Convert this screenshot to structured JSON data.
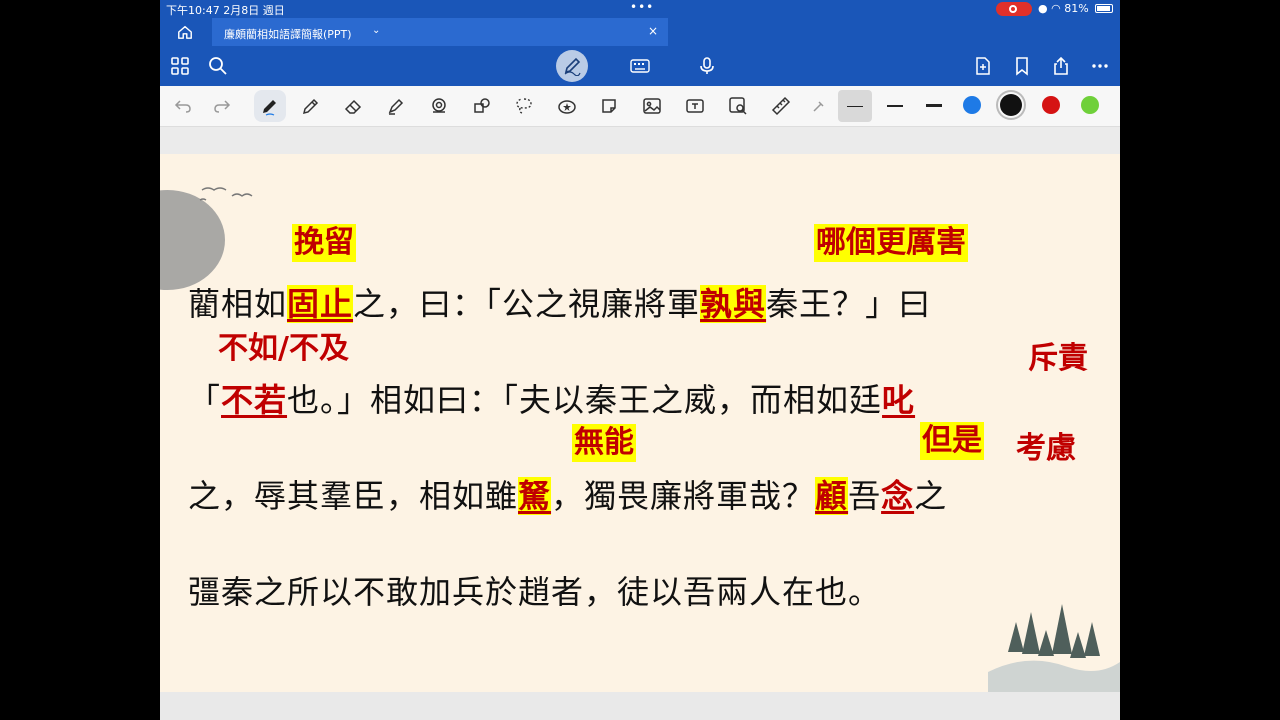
{
  "status_bar": {
    "time_date": "下午10:47   2月8日 週日",
    "battery": "81%"
  },
  "tab": {
    "title": "廉頗藺相如語譯簡報(PPT)",
    "chevron": "⌄",
    "close": "×"
  },
  "toolbar_icons": [
    "grid-icon",
    "search-icon",
    "pen-mode-icon",
    "keyboard-icon",
    "microphone-icon",
    "add-page-icon",
    "bookmark-icon",
    "share-icon",
    "more-icon"
  ],
  "draw_tools": [
    "undo-icon",
    "redo-icon",
    "pen-icon",
    "pencil-icon",
    "eraser-icon",
    "highlighter-icon",
    "lasso-icon",
    "shapes-icon",
    "lasso-select-icon",
    "sticker-icon",
    "sticky-note-icon",
    "image-icon",
    "text-box-icon",
    "image-search-icon",
    "ruler-icon",
    "laser-icon"
  ],
  "colors": {
    "accent": "#1a56b8",
    "red": "#c00000",
    "highlight": "#ffff00",
    "slide_bg": "#fdf3e4"
  },
  "swatches": [
    {
      "name": "blue",
      "color": "#1e7ae6"
    },
    {
      "name": "black",
      "color": "#111111"
    },
    {
      "name": "red",
      "color": "#d51313"
    },
    {
      "name": "green",
      "color": "#6fd03a"
    }
  ],
  "slide": {
    "line1": {
      "a": "藺相如",
      "b": "固止",
      "c": "之，曰：「公之視廉將軍",
      "d": "孰與",
      "e": "秦王？」曰"
    },
    "line2": {
      "a": "「",
      "b": "不若",
      "c": "也。」相如曰：「夫以秦王之威，而相如廷",
      "d": "叱"
    },
    "line3": {
      "a": "之，辱其羣臣，相如雖",
      "b": "駑",
      "c": "，獨畏廉將軍哉？",
      "d": "顧",
      "e": "吾",
      "f": "念",
      "g": "之"
    },
    "line4": "彊秦之所以不敢加兵於趙者，徒以吾兩人在也。",
    "notes": {
      "wanliu": "挽留",
      "nage": "哪個更厲害",
      "buru": "不如/不及",
      "chize": "斥責",
      "wuneng": "無能",
      "danshi": "但是",
      "kaolu": "考慮"
    }
  }
}
